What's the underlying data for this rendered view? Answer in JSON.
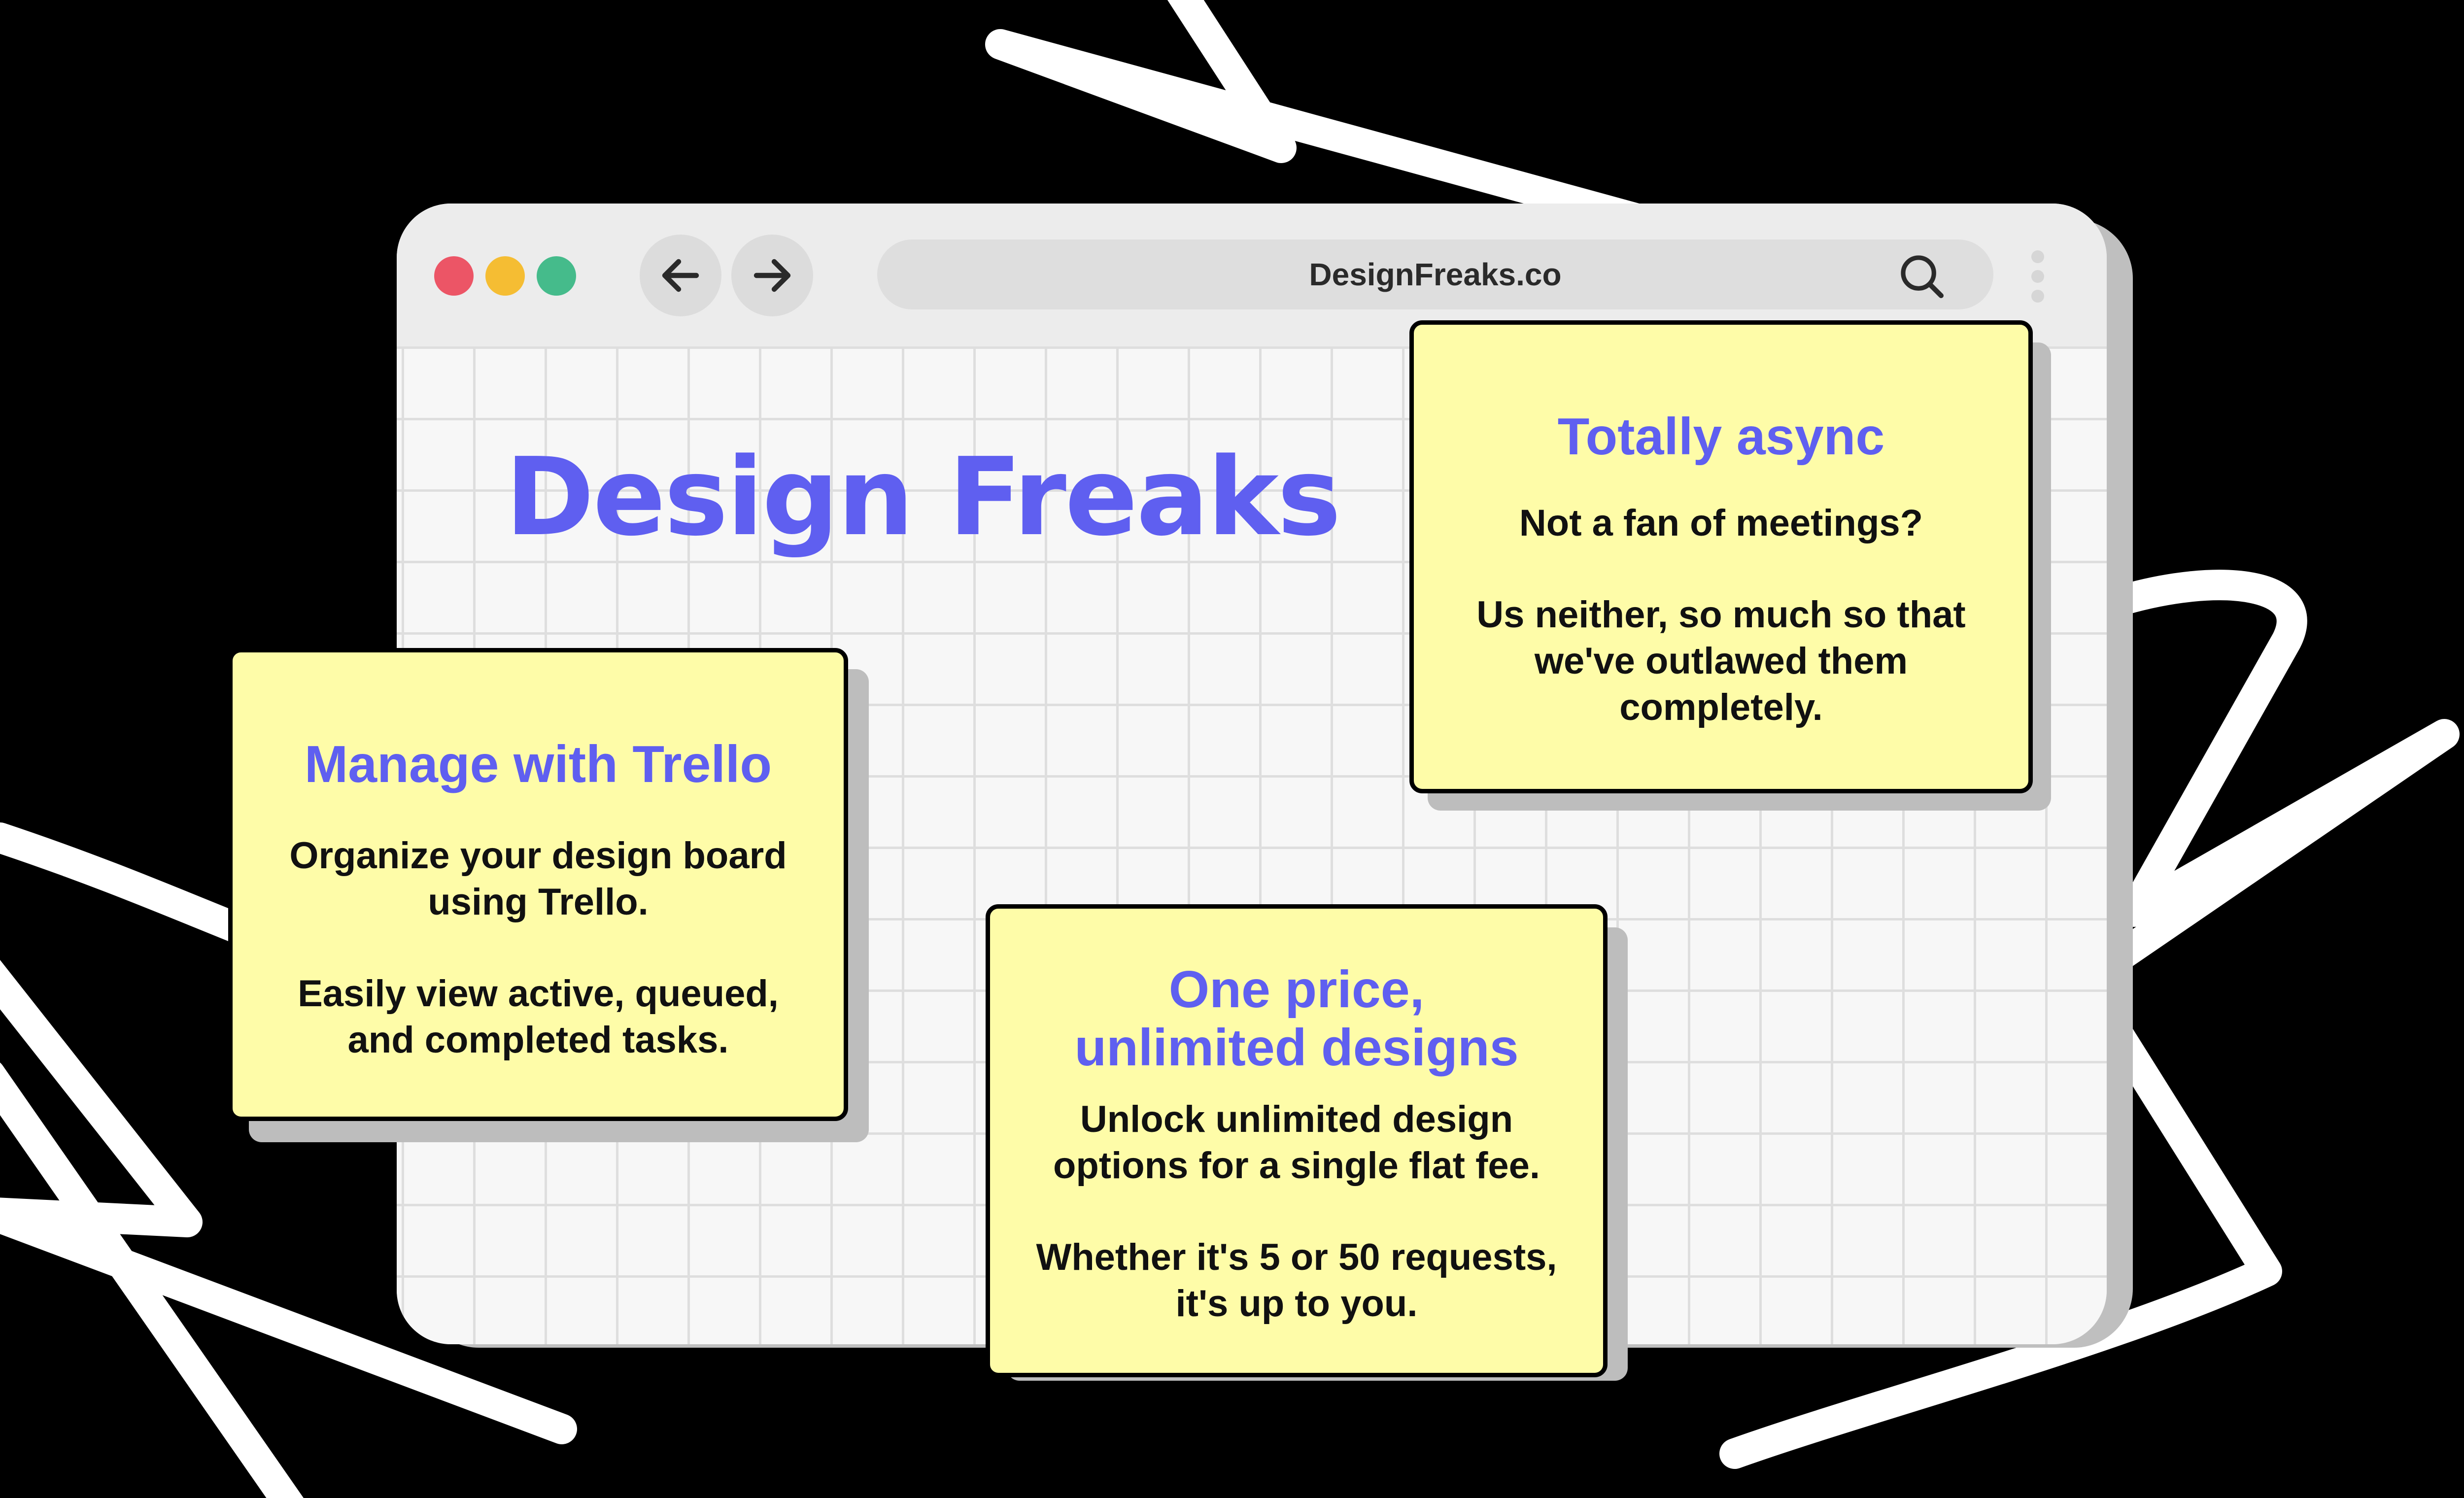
{
  "background_color": "#000000",
  "accent_color": "#5f5ff0",
  "card_color": "#fefca8",
  "browser": {
    "url": "DesignFreaks.co",
    "traffic_light_colors": [
      "#ec5566",
      "#f5bd33",
      "#45bb8b"
    ],
    "back_icon": "arrow-left-icon",
    "forward_icon": "arrow-right-icon",
    "search_icon": "search-icon",
    "menu_icon": "kebab-menu-icon"
  },
  "page": {
    "brand_title": "Design Freaks"
  },
  "cards": {
    "async": {
      "title": "Totally async",
      "text_1": "Not a fan of meetings?",
      "text_2": "Us neither, so much so that we've outlawed them completely."
    },
    "trello": {
      "title": "Manage with Trello",
      "text_1": "Organize your design board using Trello.",
      "text_2": "Easily view active, queued, and completed tasks."
    },
    "price": {
      "title": "One price, unlimited designs",
      "text_1": "Unlock unlimited design options for a single flat fee.",
      "text_2": "Whether it's 5 or 50 requests, it's up to you."
    }
  }
}
